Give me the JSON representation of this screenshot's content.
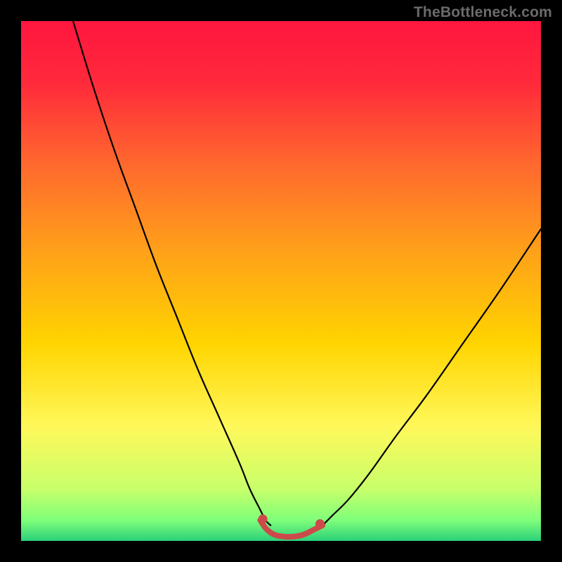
{
  "watermark": "TheBottleneck.com",
  "chart_data": {
    "type": "line",
    "title": "",
    "xlabel": "",
    "ylabel": "",
    "xlim": [
      0,
      100
    ],
    "ylim": [
      0,
      100
    ],
    "gradient_stops": [
      {
        "offset": 0.0,
        "color": "#ff163f"
      },
      {
        "offset": 0.12,
        "color": "#ff2a3b"
      },
      {
        "offset": 0.28,
        "color": "#ff6a2d"
      },
      {
        "offset": 0.45,
        "color": "#ffa318"
      },
      {
        "offset": 0.62,
        "color": "#ffd400"
      },
      {
        "offset": 0.78,
        "color": "#fff85a"
      },
      {
        "offset": 0.9,
        "color": "#c8ff6a"
      },
      {
        "offset": 0.96,
        "color": "#7fff7a"
      },
      {
        "offset": 1.0,
        "color": "#2bd07a"
      }
    ],
    "series": [
      {
        "name": "left-curve",
        "stroke": "#000000",
        "x": [
          10,
          14,
          18,
          22,
          26,
          30,
          34,
          38,
          42,
          44,
          46,
          47,
          48
        ],
        "y": [
          100,
          87,
          75,
          64,
          53,
          43,
          33,
          24,
          15,
          10,
          6,
          4,
          3
        ]
      },
      {
        "name": "right-curve",
        "stroke": "#000000",
        "x": [
          58,
          60,
          63,
          67,
          72,
          78,
          85,
          92,
          100
        ],
        "y": [
          3,
          5,
          8,
          13,
          20,
          28,
          38,
          48,
          60
        ]
      },
      {
        "name": "trough",
        "stroke": "#cc4a4a",
        "x": [
          46,
          47,
          48,
          49,
          50,
          51,
          52,
          53,
          54,
          55,
          56,
          57,
          58
        ],
        "y": [
          4,
          2.5,
          1.6,
          1.1,
          0.9,
          0.8,
          0.8,
          0.9,
          1.1,
          1.5,
          2.0,
          2.5,
          3
        ]
      },
      {
        "name": "trough-caps",
        "stroke": "#cc4a4a",
        "points": [
          {
            "x": 46.5,
            "y": 4.2
          },
          {
            "x": 57.5,
            "y": 3.3
          }
        ]
      }
    ]
  }
}
